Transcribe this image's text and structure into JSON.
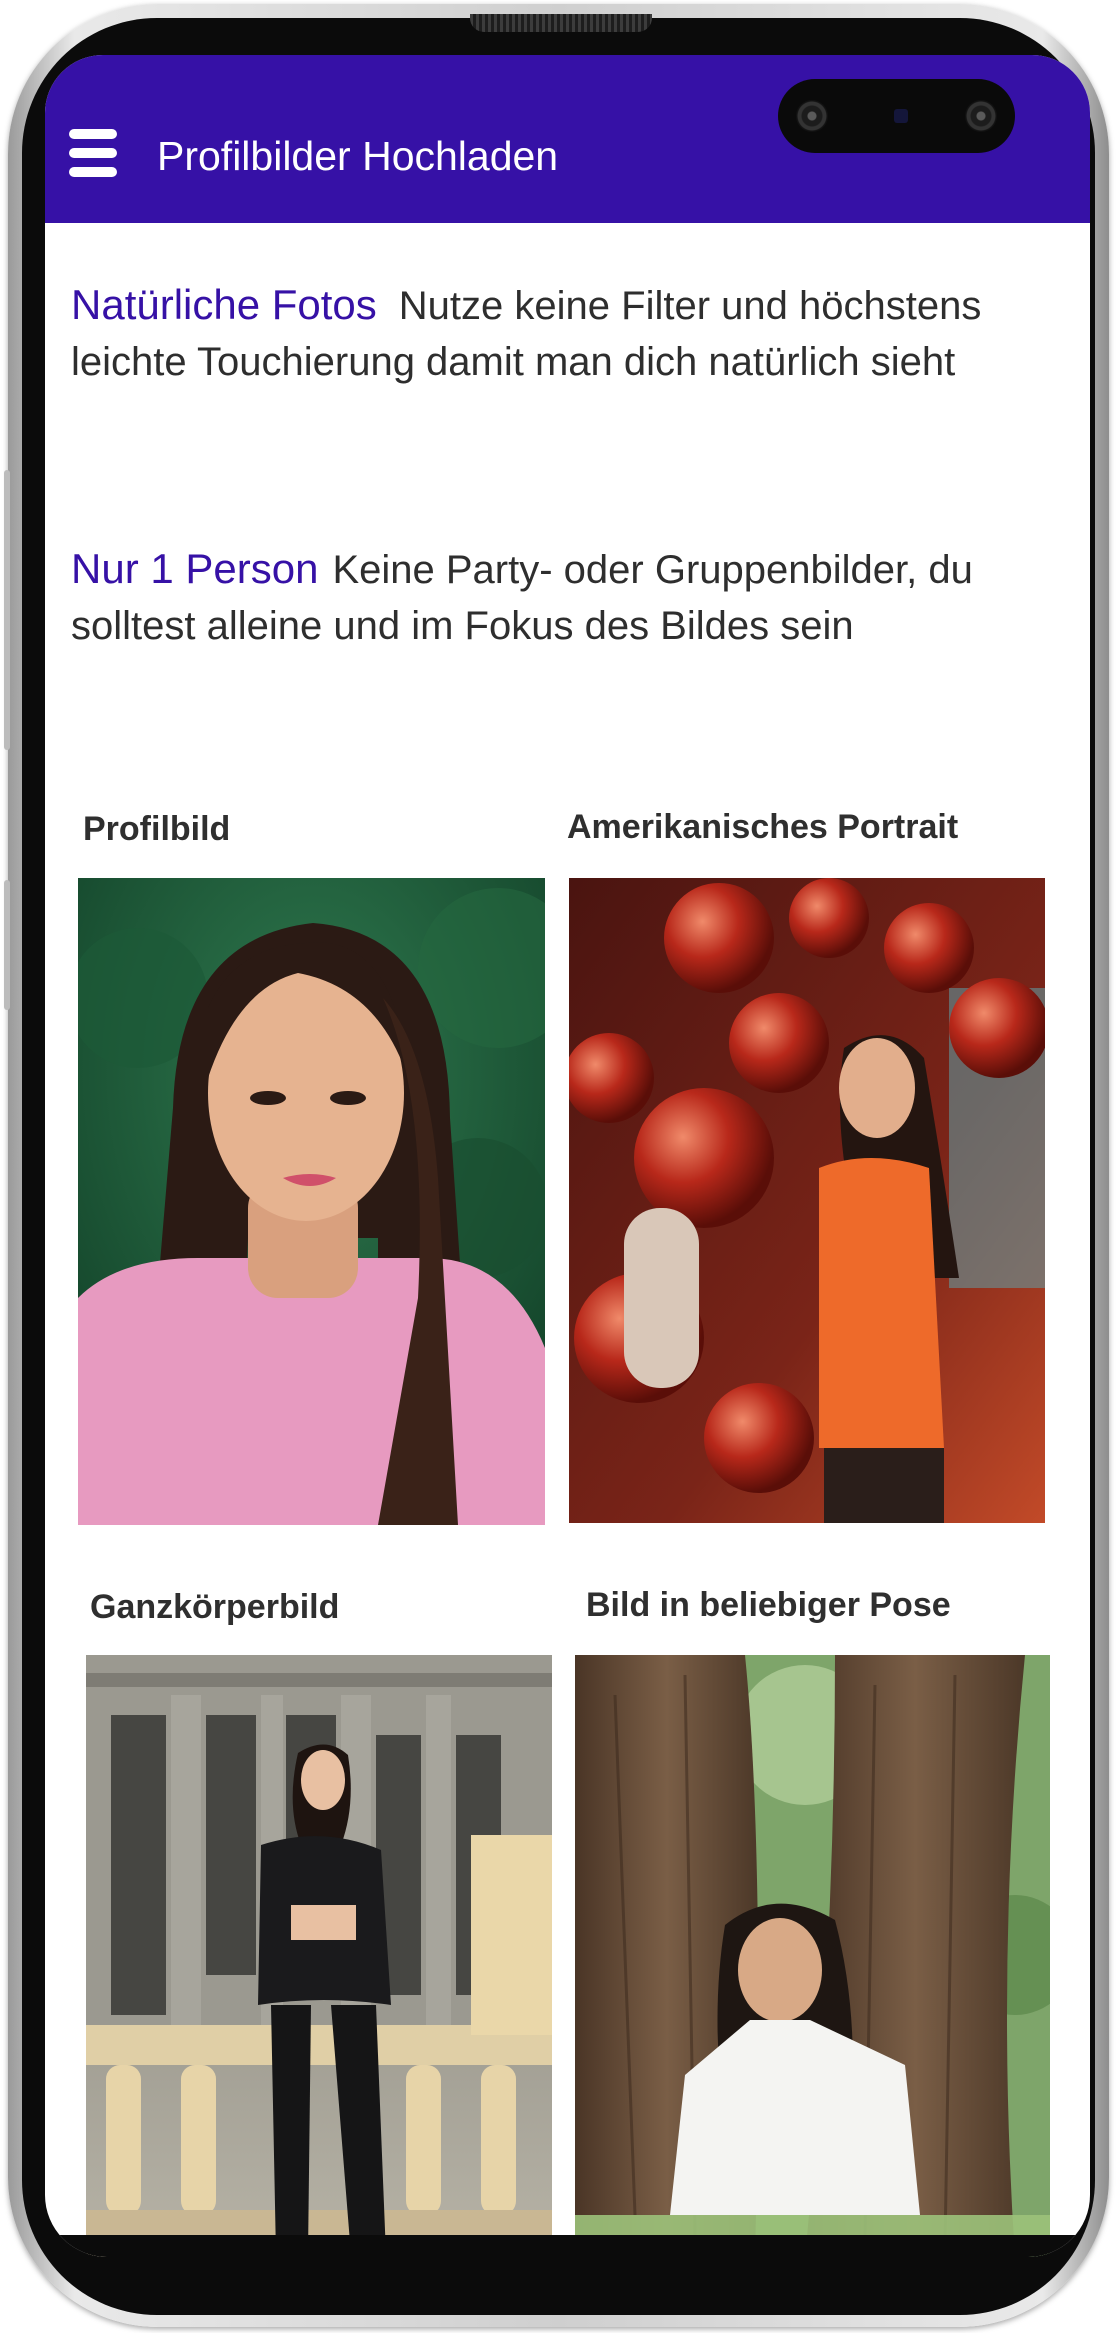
{
  "header": {
    "menu_icon": "hamburger-menu-icon",
    "title": "Profilbilder Hochladen",
    "brand_color": "#3611a6"
  },
  "tips": [
    {
      "heading": "Natürliche Fotos",
      "text": "Nutze keine Filter und höchstens leichte Touchierung damit man dich natürlich sieht"
    },
    {
      "heading": "Nur 1 Person",
      "text": "Keine Party- oder Gruppenbilder, du solltest alleine und im Fokus des Bildes sein"
    }
  ],
  "photo_grid": [
    {
      "label": "Profilbild"
    },
    {
      "label": "Amerikanisches Portrait"
    },
    {
      "label": "Ganzkörperbild"
    },
    {
      "label": "Bild in beliebiger Pose"
    }
  ]
}
